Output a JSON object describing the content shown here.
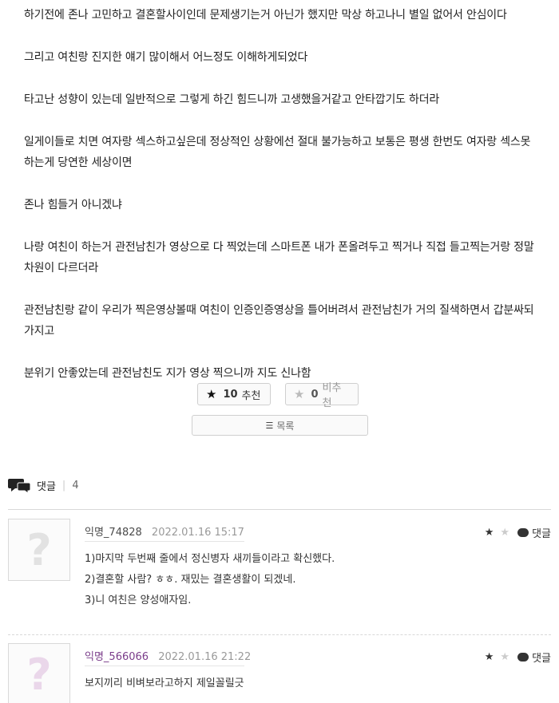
{
  "article": {
    "paragraphs": [
      "하기전에 존나 고민하고 결혼할사이인데 문제생기는거 아닌가 했지만 막상 하고나니 별일 없어서 안심이다",
      "그리고 여친랑 진지한 얘기 많이해서 어느정도 이해하게되었다",
      "타고난 성향이 있는데 일반적으로 그렇게 하긴 힘드니까 고생했을거같고 안타깝기도 하더라",
      "일게이들로 치면 여자랑 섹스하고싶은데 정상적인 상황에선 절대 불가능하고 보통은 평생 한번도 여자랑 섹스못하는게 당연한 세상이면",
      "존나 힘들거 아니겠냐",
      "나랑 여친이 하는거 관전남친가 영상으로 다 찍었는데 스마트폰 내가 폰올려두고 찍거나 직접 들고찍는거랑 정말 차원이 다르더라",
      "관전남친랑 같이 우리가 찍은영상볼때 여친이 인증인증영상을 틀어버려서 관전남친가 거의 질색하면서 갑분싸되가지고",
      "분위기 안좋았는데 관전남친도 지가 영상 찍으니까 지도 신나함"
    ]
  },
  "votes": {
    "up_count": "10",
    "up_label": "추천",
    "down_count": "0",
    "down_label": "비추천"
  },
  "list_button": {
    "label": "목록"
  },
  "comments_header": {
    "label": "댓글",
    "count": "4"
  },
  "comments": [
    {
      "author": "익명_74828",
      "date": "2022.01.16 15:17",
      "reply_label": "댓글",
      "lines": [
        "1)마지막 두번째 줄에서 정신병자 새끼들이라고 확신했다.",
        "2)결혼할 사람? ㅎㅎ. 재밌는 결혼생활이 되겠네.",
        "3)니 여친은 양성애자임."
      ]
    },
    {
      "author": "익명_566066",
      "date": "2022.01.16 21:22",
      "reply_label": "댓글",
      "lines": [
        "보지끼리 비벼보라고하지 제일꼴릴긋"
      ]
    }
  ],
  "icons": {
    "star_filled": "star-icon",
    "star_empty": "star-outline-icon",
    "comments": "speech-bubbles-icon",
    "list": "list-icon",
    "reply": "chat-bubble-icon",
    "avatar_placeholder": "question-mark-icon"
  },
  "colors": {
    "accent_purple": "#7a3c8a",
    "border": "#cfcfcf"
  }
}
